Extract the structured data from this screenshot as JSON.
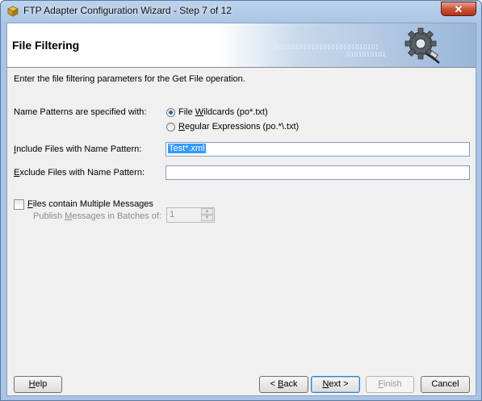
{
  "window": {
    "title": "FTP Adapter Configuration Wizard - Step 7 of 12",
    "close_label": "✕"
  },
  "header": {
    "title": "File Filtering",
    "binary_line1": "01010101010101010101010101",
    "binary_line2": "0101010101"
  },
  "description": "Enter the file filtering parameters for the Get File operation.",
  "patterns": {
    "label": "Name Patterns are specified with:",
    "options": [
      {
        "prefix": "File ",
        "mnemonic": "W",
        "suffix": "ildcards (po*.txt)",
        "checked": true
      },
      {
        "prefix": "",
        "mnemonic": "R",
        "suffix": "egular Expressions (po.*\\.txt)",
        "checked": false
      }
    ]
  },
  "include": {
    "label_mnemonic": "I",
    "label_rest": "nclude Files with Name Pattern:",
    "value": "Test*.xml"
  },
  "exclude": {
    "label_mnemonic": "E",
    "label_rest": "xclude Files with Name Pattern:",
    "value": ""
  },
  "multiple": {
    "label_mnemonic": "F",
    "label_rest": "iles contain Multiple Messages",
    "checked": false,
    "batch_label_prefix": "Publish ",
    "batch_label_mnemonic": "M",
    "batch_label_rest": "essages in Batches of:",
    "batch_value": "1"
  },
  "buttons": {
    "help_mnemonic": "H",
    "help_rest": "elp",
    "back_prefix": "< ",
    "back_mnemonic": "B",
    "back_rest": "ack",
    "next_mnemonic": "N",
    "next_rest": "ext >",
    "finish_mnemonic": "F",
    "finish_rest": "inish",
    "cancel": "Cancel"
  }
}
